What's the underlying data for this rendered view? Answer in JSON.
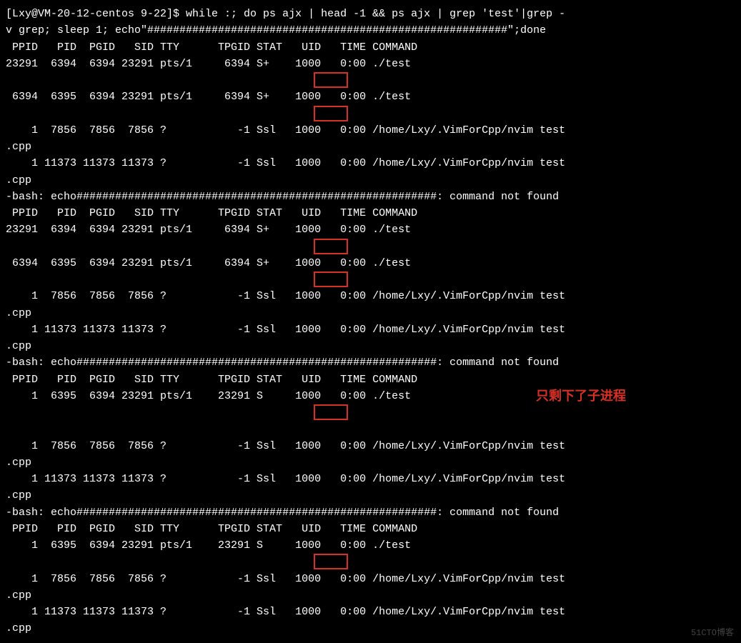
{
  "prompt_line": "[Lxy@VM-20-12-centos 9-22]$ while :; do ps ajx | head -1 && ps ajx | grep 'test'|grep -",
  "prompt_line2": "v grep; sleep 1; echo\"########################################################\";done",
  "header": " PPID   PID  PGID   SID TTY      TPGID STAT   UID   TIME COMMAND",
  "block1": {
    "r1": "23291  6394  6394 23291 pts/1     6394 S+    1000   0:00 ./test",
    "r2": " 6394  6395  6394 23291 pts/1     6394 S+    1000   0:00 ./test",
    "r3": "    1  7856  7856  7856 ?           -1 Ssl   1000   0:00 /home/Lxy/.VimForCpp/nvim test",
    "r4": ".cpp",
    "r5": "    1 11373 11373 11373 ?           -1 Ssl   1000   0:00 /home/Lxy/.VimForCpp/nvim test",
    "r6": ".cpp"
  },
  "bash_err": "-bash: echo########################################################: command not found",
  "block2": {
    "r1": "23291  6394  6394 23291 pts/1     6394 S+    1000   0:00 ./test",
    "r2": " 6394  6395  6394 23291 pts/1     6394 S+    1000   0:00 ./test",
    "r3": "    1  7856  7856  7856 ?           -1 Ssl   1000   0:00 /home/Lxy/.VimForCpp/nvim test",
    "r4": ".cpp",
    "r5": "    1 11373 11373 11373 ?           -1 Ssl   1000   0:00 /home/Lxy/.VimForCpp/nvim test",
    "r6": ".cpp"
  },
  "block3": {
    "r1": "    1  6395  6394 23291 pts/1    23291 S     1000   0:00 ./test",
    "r2": "    1  7856  7856  7856 ?           -1 Ssl   1000   0:00 /home/Lxy/.VimForCpp/nvim test",
    "r3": ".cpp",
    "r4": "    1 11373 11373 11373 ?           -1 Ssl   1000   0:00 /home/Lxy/.VimForCpp/nvim test",
    "r5": ".cpp"
  },
  "block4": {
    "r1": "    1  6395  6394 23291 pts/1    23291 S     1000   0:00 ./test",
    "r2": "    1  7856  7856  7856 ?           -1 Ssl   1000   0:00 /home/Lxy/.VimForCpp/nvim test",
    "r3": ".cpp",
    "r4": "    1 11373 11373 11373 ?           -1 Ssl   1000   0:00 /home/Lxy/.VimForCpp/nvim test",
    "r5": ".cpp"
  },
  "annotation": "只剩下了子进程",
  "watermark": "51CTO博客"
}
